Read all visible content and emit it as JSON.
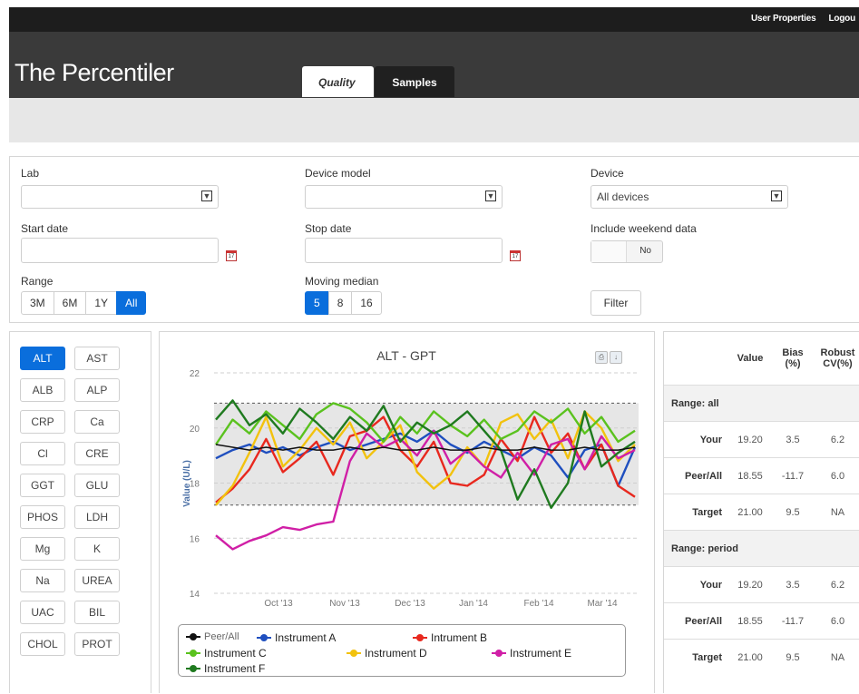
{
  "app": {
    "title": "The Percentiler"
  },
  "topbar": {
    "user_properties": "User Properties",
    "logout": "Logou"
  },
  "tabs": [
    {
      "label": "Quality"
    },
    {
      "label": "Samples"
    }
  ],
  "filters": {
    "lab_label": "Lab",
    "device_model_label": "Device model",
    "device_label": "Device",
    "device_value": "All devices",
    "start_date_label": "Start date",
    "stop_date_label": "Stop date",
    "weekend_label": "Include weekend data",
    "weekend_value": "No",
    "range_label": "Range",
    "range_options": [
      "3M",
      "6M",
      "1Y",
      "All"
    ],
    "range_selected": "All",
    "median_label": "Moving median",
    "median_options": [
      "5",
      "8",
      "16"
    ],
    "median_selected": "5",
    "filter_button": "Filter",
    "calendar_day": "17"
  },
  "analytes": {
    "selected": "ALT",
    "items": [
      "ALT",
      "AST",
      "ALB",
      "ALP",
      "CRP",
      "Ca",
      "Cl",
      "CRE",
      "GGT",
      "GLU",
      "PHOS",
      "LDH",
      "Mg",
      "K",
      "Na",
      "UREA",
      "UAC",
      "BIL",
      "CHOL",
      "PROT"
    ]
  },
  "icons": {
    "print": "print-icon",
    "download": "download-icon",
    "calendar": "calendar-icon",
    "dropdown": "chevron-down-icon"
  },
  "chart_data": {
    "type": "line",
    "title": "ALT - GPT",
    "ylabel": "Value (U/L)",
    "ylim": [
      14,
      22
    ],
    "yticks": [
      14,
      16,
      18,
      20,
      22
    ],
    "xticks": [
      "Oct '13",
      "Nov '13",
      "Dec '13",
      "Jan '14",
      "Feb '14",
      "Mar '14"
    ],
    "x": [
      "Sep 25",
      "Oct 2",
      "Oct 9",
      "Oct 16",
      "Oct 23",
      "Oct 30",
      "Nov 6",
      "Nov 13",
      "Nov 20",
      "Nov 27",
      "Dec 4",
      "Dec 11",
      "Dec 18",
      "Dec 25",
      "Jan 1",
      "Jan 8",
      "Jan 15",
      "Jan 22",
      "Jan 29",
      "Feb 5",
      "Feb 12",
      "Feb 19",
      "Feb 26",
      "Mar 5",
      "Mar 12",
      "Mar 19"
    ],
    "reference_lines": {
      "peer_median": 19.2,
      "upper_limit": 20.9,
      "lower_limit": 17.2
    },
    "series": [
      {
        "name": "Peer/All",
        "color": "#111111",
        "values": [
          19.4,
          19.3,
          19.2,
          19.3,
          19.2,
          19.3,
          19.2,
          19.2,
          19.3,
          19.2,
          19.3,
          19.2,
          19.2,
          19.3,
          19.2,
          19.2,
          19.3,
          19.2,
          19.2,
          19.3,
          19.2,
          19.2,
          19.3,
          19.2,
          19.2,
          19.3
        ]
      },
      {
        "name": "Instrument A",
        "color": "#1f4fbf",
        "values": [
          18.9,
          19.2,
          19.4,
          19.1,
          19.3,
          19.0,
          19.3,
          19.5,
          19.2,
          19.4,
          19.6,
          19.8,
          19.5,
          19.9,
          19.4,
          19.1,
          19.5,
          19.2,
          18.9,
          19.3,
          19.0,
          18.2,
          19.2,
          19.4,
          17.9,
          19.3
        ]
      },
      {
        "name": "Intrument B",
        "color": "#e8281e",
        "values": [
          17.3,
          17.8,
          18.5,
          19.6,
          18.4,
          18.9,
          19.5,
          18.3,
          19.7,
          19.9,
          20.4,
          19.2,
          18.6,
          19.5,
          18.0,
          17.9,
          18.3,
          19.6,
          18.8,
          20.4,
          19.1,
          19.8,
          18.5,
          19.4,
          17.9,
          17.5
        ]
      },
      {
        "name": "Instrument C",
        "color": "#5ac21e",
        "values": [
          19.4,
          20.3,
          19.8,
          20.6,
          20.1,
          19.6,
          20.5,
          20.9,
          20.7,
          20.2,
          19.5,
          20.4,
          19.8,
          20.6,
          20.1,
          19.7,
          20.3,
          19.6,
          19.9,
          20.6,
          20.2,
          20.7,
          19.8,
          20.4,
          19.5,
          19.9
        ]
      },
      {
        "name": "Instrument D",
        "color": "#f2c20e",
        "values": [
          17.2,
          17.9,
          19.1,
          20.4,
          18.6,
          19.2,
          20.0,
          19.4,
          20.2,
          18.9,
          19.5,
          20.1,
          18.4,
          17.8,
          18.3,
          19.3,
          18.6,
          20.2,
          20.5,
          19.6,
          20.3,
          18.9,
          20.6,
          20.0,
          18.8,
          19.4
        ]
      },
      {
        "name": "Instrument E",
        "color": "#d01fa6",
        "values": [
          16.1,
          15.6,
          15.9,
          16.1,
          16.4,
          16.3,
          16.5,
          16.6,
          18.8,
          19.8,
          19.3,
          19.6,
          19.0,
          19.9,
          18.7,
          19.2,
          18.6,
          18.2,
          19.1,
          18.3,
          19.4,
          19.6,
          18.5,
          19.7,
          18.9,
          19.2
        ]
      },
      {
        "name": "Instrument F",
        "color": "#1f7a1f",
        "values": [
          20.3,
          21.0,
          20.1,
          20.5,
          19.8,
          20.7,
          20.2,
          19.6,
          20.4,
          19.9,
          20.8,
          19.5,
          20.2,
          19.8,
          20.1,
          20.6,
          19.9,
          19.2,
          17.4,
          18.5,
          17.1,
          18.0,
          20.6,
          18.6,
          19.1,
          19.5
        ]
      }
    ]
  },
  "stats": {
    "headers": [
      "",
      "Value",
      "Bias (%)",
      "Robust CV(%)"
    ],
    "groups": [
      {
        "title": "Range: all",
        "rows": [
          {
            "label": "Your",
            "value": "19.20",
            "bias": "3.5",
            "cv": "6.2"
          },
          {
            "label": "Peer/All",
            "value": "18.55",
            "bias": "-11.7",
            "cv": "6.0"
          },
          {
            "label": "Target",
            "value": "21.00",
            "bias": "9.5",
            "cv": "NA"
          }
        ]
      },
      {
        "title": "Range: period",
        "rows": [
          {
            "label": "Your",
            "value": "19.20",
            "bias": "3.5",
            "cv": "6.2"
          },
          {
            "label": "Peer/All",
            "value": "18.55",
            "bias": "-11.7",
            "cv": "6.0"
          },
          {
            "label": "Target",
            "value": "21.00",
            "bias": "9.5",
            "cv": "NA"
          }
        ]
      }
    ]
  }
}
